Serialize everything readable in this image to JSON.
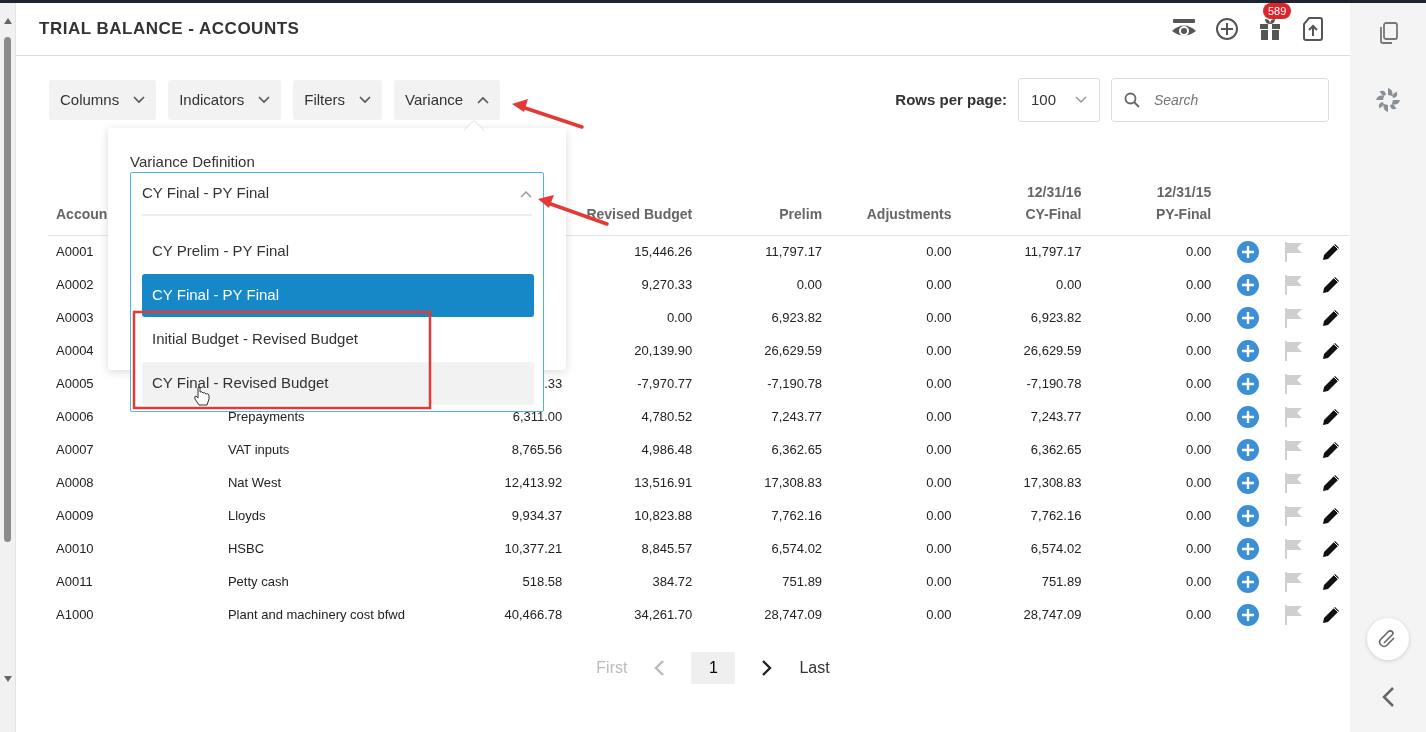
{
  "header": {
    "title": "TRIAL BALANCE - ACCOUNTS",
    "notification_badge": "589"
  },
  "toolbar": {
    "menus": [
      {
        "label": "Columns",
        "open": false
      },
      {
        "label": "Indicators",
        "open": false
      },
      {
        "label": "Filters",
        "open": false
      },
      {
        "label": "Variance",
        "open": true
      }
    ],
    "rows_per_page_label": "Rows per page:",
    "rows_per_page": "100",
    "search": {
      "placeholder": "Search"
    }
  },
  "variance_popup": {
    "label": "Variance Definition",
    "value": "CY Final - PY Final",
    "expanded": true,
    "options": [
      {
        "label": "CY Prelim - PY Final",
        "selected": false,
        "hovered": false
      },
      {
        "label": "CY Final - PY Final",
        "selected": true,
        "hovered": false
      },
      {
        "label": "Initial Budget - Revised Budget",
        "selected": false,
        "hovered": false
      },
      {
        "label": "CY Final - Revised Budget",
        "selected": false,
        "hovered": true
      }
    ]
  },
  "table": {
    "columns": [
      {
        "label": "Accoun"
      },
      null,
      null,
      {
        "label": "Revised Budget"
      },
      {
        "label": "Prelim"
      },
      {
        "label": "Adjustments"
      },
      {
        "date": "12/31/16",
        "label": "CY-Final"
      },
      {
        "date": "12/31/15",
        "label": "PY-Final"
      }
    ],
    "rows": [
      {
        "cells": [
          "A0001",
          null,
          null,
          "15,446.26",
          "11,797.17",
          "0.00",
          "11,797.17",
          "0.00"
        ],
        "flagged": false
      },
      {
        "cells": [
          "A0002",
          null,
          null,
          "9,270.33",
          "0.00",
          "0.00",
          "0.00",
          "0.00"
        ],
        "flagged": false
      },
      {
        "cells": [
          "A0003",
          null,
          null,
          "0.00",
          "6,923.82",
          "0.00",
          "6,923.82",
          "0.00"
        ],
        "flagged": false
      },
      {
        "cells": [
          "A0004",
          null,
          null,
          "20,139.90",
          "26,629.59",
          "0.00",
          "26,629.59",
          "0.00"
        ],
        "flagged": false
      },
      {
        "cells": [
          "A0005",
          null,
          ".33",
          "-7,970.77",
          "-7,190.78",
          "0.00",
          "-7,190.78",
          "0.00"
        ],
        "flagged": false
      },
      {
        "cells": [
          "A0006",
          "Prepayments",
          "6,311.00",
          "4,780.52",
          "7,243.77",
          "0.00",
          "7,243.77",
          "0.00"
        ],
        "flagged": false
      },
      {
        "cells": [
          "A0007",
          "VAT inputs",
          "8,765.56",
          "4,986.48",
          "6,362.65",
          "0.00",
          "6,362.65",
          "0.00"
        ],
        "flagged": false
      },
      {
        "cells": [
          "A0008",
          "Nat West",
          "12,413.92",
          "13,516.91",
          "17,308.83",
          "0.00",
          "17,308.83",
          "0.00"
        ],
        "flagged": false
      },
      {
        "cells": [
          "A0009",
          "Lloyds",
          "9,934.37",
          "10,823.88",
          "7,762.16",
          "0.00",
          "7,762.16",
          "0.00"
        ],
        "flagged": false
      },
      {
        "cells": [
          "A0010",
          "HSBC",
          "10,377.21",
          "8,845.57",
          "6,574.02",
          "0.00",
          "6,574.02",
          "0.00"
        ],
        "flagged": false
      },
      {
        "cells": [
          "A0011",
          "Petty cash",
          "518.58",
          "384.72",
          "751.89",
          "0.00",
          "751.89",
          "0.00"
        ],
        "flagged": false
      },
      {
        "cells": [
          "A1000",
          "Plant and machinery cost bfwd",
          "40,466.78",
          "34,261.70",
          "28,747.09",
          "0.00",
          "28,747.09",
          "0.00"
        ],
        "flagged": false
      }
    ]
  },
  "pagination": {
    "first": {
      "label": "First",
      "disabled": true
    },
    "previous_disabled": true,
    "pages": [
      {
        "label": "1",
        "selected": true
      }
    ],
    "next_disabled": false,
    "last": {
      "label": "Last",
      "disabled": false
    }
  }
}
